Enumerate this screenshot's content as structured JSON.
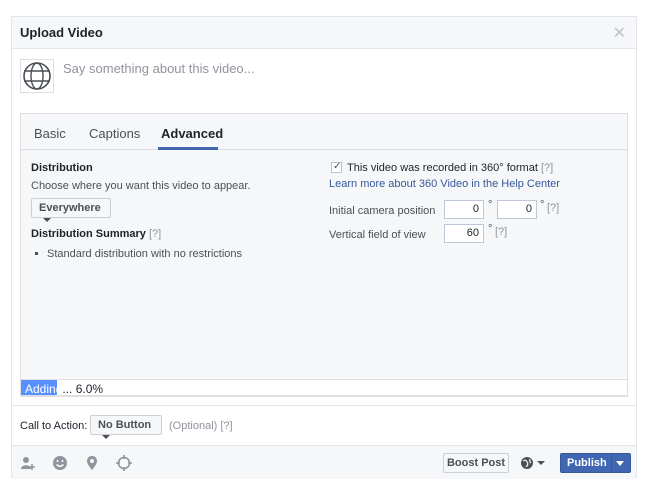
{
  "dialog": {
    "title": "Upload Video"
  },
  "composer": {
    "placeholder": "Say something about this video..."
  },
  "tabs": [
    {
      "label": "Basic"
    },
    {
      "label": "Captions"
    },
    {
      "label": "Advanced"
    }
  ],
  "distribution": {
    "heading": "Distribution",
    "description": "Choose where you want this video to appear.",
    "dropdown_value": "Everywhere",
    "summary_heading": "Distribution Summary",
    "summary_help": "[?]",
    "summary_items": [
      "Standard distribution with no restrictions"
    ]
  },
  "video360": {
    "checkbox_label": "This video was recorded in 360° format",
    "checkbox_help": "[?]",
    "checked": true,
    "learn_more": "Learn more about 360 Video in the Help Center",
    "camera_label": "Initial camera position",
    "camera_values": [
      "0",
      "0"
    ],
    "camera_help": "[?]",
    "fov_label": "Vertical field of view",
    "fov_value": "60",
    "fov_help": "[?]",
    "degree_symbol": "°"
  },
  "upload": {
    "status_prefix": "Adding",
    "status_suffix": "... 6.0%",
    "progress_percent": 6.0
  },
  "cta": {
    "label": "Call to Action:",
    "button": "No Button",
    "optional": "(Optional)",
    "help": "[?]"
  },
  "footer": {
    "boost": "Boost Post",
    "publish": "Publish"
  },
  "colors": {
    "accent": "#4267b2",
    "progress": "#5890ff",
    "link": "#365899"
  },
  "icons": [
    "tag-people-icon",
    "feeling-icon",
    "location-icon",
    "target-icon",
    "globe-icon",
    "close-icon",
    "video-360-icon"
  ]
}
